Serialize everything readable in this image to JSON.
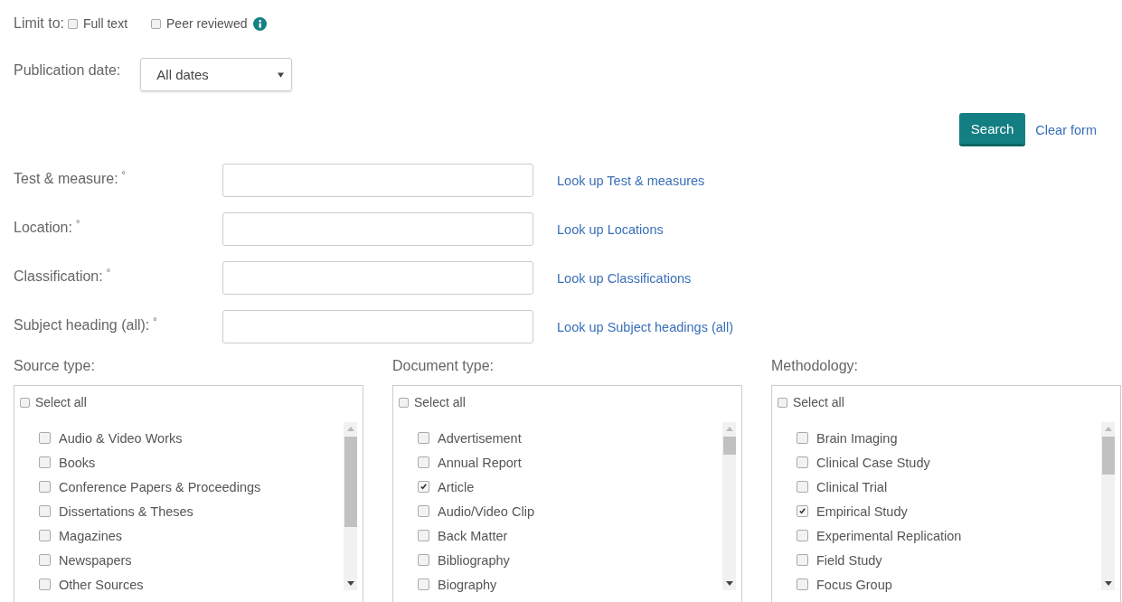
{
  "limit_to": {
    "label": "Limit to:",
    "options": [
      {
        "label": "Full text",
        "checked": false,
        "info": false
      },
      {
        "label": "Peer reviewed",
        "checked": false,
        "info": true
      }
    ]
  },
  "publication_date": {
    "label": "Publication date:",
    "value": "All dates"
  },
  "actions": {
    "search": "Search",
    "clear": "Clear form"
  },
  "fields": [
    {
      "label": "Test & measure:",
      "marker": "°",
      "lookup": "Look up Test & measures"
    },
    {
      "label": "Location:",
      "marker": "°",
      "lookup": "Look up Locations"
    },
    {
      "label": "Classification:",
      "marker": "°",
      "lookup": "Look up Classifications"
    },
    {
      "label": "Subject heading (all):",
      "marker": "°",
      "lookup": "Look up Subject headings (all)"
    }
  ],
  "lists": [
    {
      "heading": "Source type:",
      "select_all": {
        "label": "Select all",
        "checked": false
      },
      "items": [
        {
          "label": "Audio & Video Works",
          "checked": false
        },
        {
          "label": "Books",
          "checked": false
        },
        {
          "label": "Conference Papers & Proceedings",
          "checked": false
        },
        {
          "label": "Dissertations & Theses",
          "checked": false
        },
        {
          "label": "Magazines",
          "checked": false
        },
        {
          "label": "Newspapers",
          "checked": false
        },
        {
          "label": "Other Sources",
          "checked": false
        }
      ]
    },
    {
      "heading": "Document type:",
      "select_all": {
        "label": "Select all",
        "checked": false
      },
      "items": [
        {
          "label": "Advertisement",
          "checked": false
        },
        {
          "label": "Annual Report",
          "checked": false
        },
        {
          "label": "Article",
          "checked": true
        },
        {
          "label": "Audio/Video Clip",
          "checked": false
        },
        {
          "label": "Back Matter",
          "checked": false
        },
        {
          "label": "Bibliography",
          "checked": false
        },
        {
          "label": "Biography",
          "checked": false
        }
      ]
    },
    {
      "heading": "Methodology:",
      "select_all": {
        "label": "Select all",
        "checked": false
      },
      "items": [
        {
          "label": "Brain Imaging",
          "checked": false
        },
        {
          "label": "Clinical Case Study",
          "checked": false
        },
        {
          "label": "Clinical Trial",
          "checked": false
        },
        {
          "label": "Empirical Study",
          "checked": true
        },
        {
          "label": "Experimental Replication",
          "checked": false
        },
        {
          "label": "Field Study",
          "checked": false
        },
        {
          "label": "Focus Group",
          "checked": false
        }
      ]
    }
  ]
}
